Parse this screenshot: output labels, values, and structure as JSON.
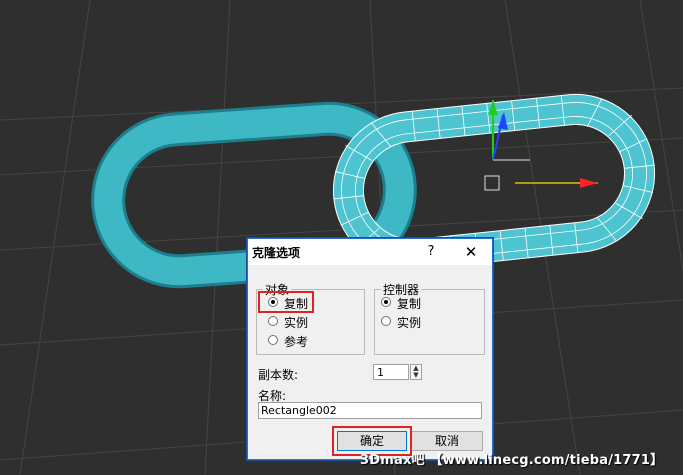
{
  "dialog": {
    "title": "克隆选项",
    "help_label": "?",
    "close_label": "✕",
    "object_group": {
      "legend": "对象",
      "options": [
        {
          "label": "复制",
          "checked": true
        },
        {
          "label": "实例",
          "checked": false
        },
        {
          "label": "参考",
          "checked": false
        }
      ]
    },
    "controller_group": {
      "legend": "控制器",
      "options": [
        {
          "label": "复制",
          "checked": true
        },
        {
          "label": "实例",
          "checked": false
        }
      ]
    },
    "copies_label": "副本数:",
    "copies_value": "1",
    "name_label": "名称:",
    "name_value": "Rectangle002",
    "ok_label": "确定",
    "cancel_label": "取消"
  },
  "watermark": "3Dmax吧 【www.linecg.com/tieba/1771】",
  "colors": {
    "viewport_bg": "#2f2f2f",
    "grid": "#444444",
    "link_color": "#3fb8c6",
    "selection_wire": "#ffffff",
    "highlight": "#e02222"
  },
  "icons": {
    "gizmo": "transform-gizmo-icon"
  }
}
